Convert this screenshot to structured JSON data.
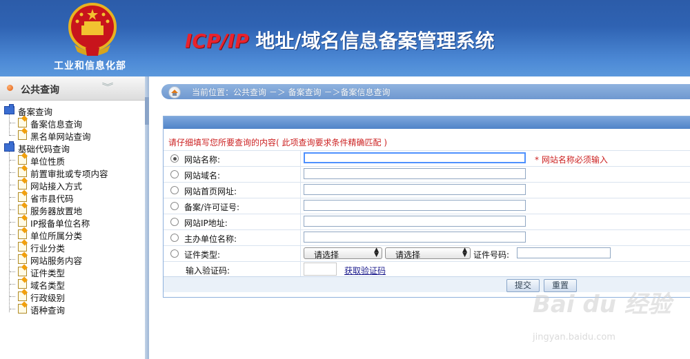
{
  "header": {
    "ministry": "工业和信息化部",
    "title_red": "ICP/IP",
    "title_rest": " 地址/域名信息备案管理系统"
  },
  "sidebar": {
    "title": "公共查询",
    "groups": [
      {
        "label": "备案查询",
        "items": [
          "备案信息查询",
          "黑名单网站查询"
        ]
      },
      {
        "label": "基础代码查询",
        "items": [
          "单位性质",
          "前置审批或专项内容",
          "网站接入方式",
          "省市县代码",
          "服务器放置地",
          "IP报备单位名称",
          "单位所属分类",
          "行业分类",
          "网站服务内容",
          "证件类型",
          "域名类型",
          "行政级别",
          "语种查询"
        ]
      }
    ]
  },
  "breadcrumb": "当前位置：公共查询  －＞  备案查询  －＞备案信息查询",
  "form": {
    "notice": "请仔细填写您所要查询的内容( 此项查询要求条件精确匹配 )",
    "required_msg": "* 网站名称必须输入",
    "rows": [
      {
        "label": "网站名称:",
        "checked": true
      },
      {
        "label": "网站域名:",
        "checked": false
      },
      {
        "label": "网站首页网址:",
        "checked": false
      },
      {
        "label": "备案/许可证号:",
        "checked": false
      },
      {
        "label": "网站IP地址:",
        "checked": false
      },
      {
        "label": "主办单位名称:",
        "checked": false
      },
      {
        "label": "证件类型:",
        "checked": false
      }
    ],
    "select1": "请选择",
    "select2": "请选择",
    "id_number_label": "证件号码:",
    "captcha_label": "输入验证码:",
    "captcha_link": "获取验证码",
    "submit": "提交",
    "reset": "重置"
  },
  "watermark": {
    "brand": "Bai du 经验",
    "url": "jingyan.baidu.com"
  },
  "colors": {
    "header": "#2f63b3",
    "title_red": "#e8232d",
    "notice_red": "#cc2222",
    "panel_border": "#8db0dc"
  }
}
